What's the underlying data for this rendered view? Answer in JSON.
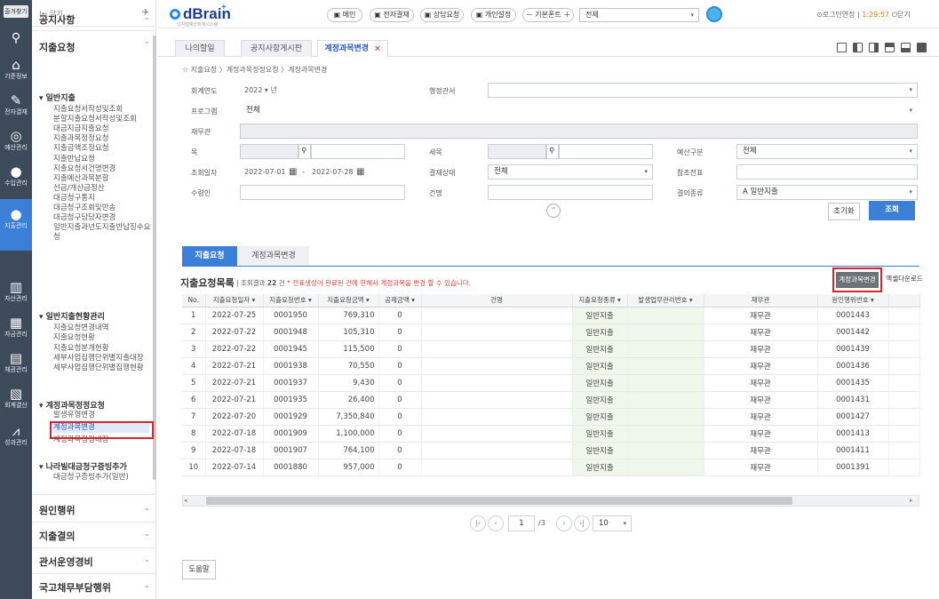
{
  "rail": {
    "favorites": "즐겨찾기",
    "items": [
      {
        "label": "기준정보",
        "icon": "house-icon"
      },
      {
        "label": "전자결재",
        "icon": "pen-icon"
      },
      {
        "label": "예산관리",
        "icon": "coins-icon"
      },
      {
        "label": "수입관리",
        "icon": "income-icon"
      },
      {
        "label": "지출관리",
        "icon": "expense-icon"
      },
      {
        "label": "자산관리",
        "icon": "building-icon"
      },
      {
        "label": "자금관리",
        "icon": "money-icon"
      },
      {
        "label": "채권관리",
        "icon": "bond-icon"
      },
      {
        "label": "회계결산",
        "icon": "document-icon"
      },
      {
        "label": "성과관리",
        "icon": "chart-icon"
      }
    ]
  },
  "sidebar": {
    "close": "|← 닫기",
    "sections_top": [
      {
        "label": "공지사항"
      },
      {
        "label": "지출요청"
      }
    ],
    "group1": "▾ 일반지출",
    "group1_items": [
      "지출요청서작성및조회",
      "분할지출요청서작성및조회",
      "대금지급지출요청",
      "지출과목정정요청",
      "지출금액조정요청",
      "지출반납요청",
      "지출요청서건명변경",
      "지출예산과목분할",
      "선급/개산급정산",
      "대금청구통지",
      "대금청구조회및반송",
      "대금청구담당자변경",
      "일반지출과년도지출반납징수요",
      "청"
    ],
    "group2": "▾ 일반지출현황관리",
    "group2_items": [
      "지출요청변경내역",
      "지출요청현황",
      "지출요청분개현황",
      "세부사업집행단위별지출대장",
      "세부사업집행단위별집행현황"
    ],
    "group3": "▾ 계정과목정정요청",
    "group3_items": [
      "발생유형변경",
      "계정과목변경",
      "계정과목정정내장"
    ],
    "group4": "▾ 나라빌대금청구증빙추가",
    "group4_items": [
      "대금청구증빙추가(일반)"
    ],
    "sections_bottom": [
      "원인행위",
      "지출결의",
      "관서운영경비",
      "국고채무부담행위"
    ]
  },
  "topbar": {
    "logo": "dBrain",
    "logo_plus": "+",
    "logo_sub": "디지털예산회계시스템",
    "buttons": [
      "메인",
      "전자결재",
      "상담요청",
      "개인설정"
    ],
    "font": "－ 기본폰트 ＋",
    "view_select": "전체",
    "login_ext": "⊙로그인연장",
    "timer": "1:29:57",
    "close": "⏻닫기"
  },
  "tabs": {
    "items": [
      {
        "label": "나의할일"
      },
      {
        "label": "공지사항게시판"
      },
      {
        "label": "계정과목변경",
        "close": "×"
      }
    ]
  },
  "breadcrumb": "☆ 지출요청 〉계정과목정정요청 〉계정과목변경",
  "form": {
    "fiscal_year_label": "회계연도",
    "fiscal_year": "2022",
    "year_unit": "▾ 년",
    "ministry_label": "행정관서",
    "ministry": "",
    "program_label": "프로그램",
    "program": "전체",
    "officer_label": "재무관",
    "officer": "",
    "item_label": "목",
    "item": "",
    "sub_item_label": "세목",
    "sub_item": "",
    "budget_type_label": "예산구분",
    "budget_type": "전체",
    "date_label": "조회일자",
    "date_from": "2022-07-01",
    "date_to": "2022-07-28",
    "approval_label": "결재상태",
    "approval": "전체",
    "ref_label": "참조전표",
    "ref": "",
    "payee_label": "수령인",
    "payee": "",
    "title_label": "건명",
    "title": "",
    "resolution_label": "결의종류",
    "resolution": "A 일반지출",
    "reset": "초기화",
    "search": "조회"
  },
  "subtabs": {
    "a": "지출요청",
    "b": "계정과목변경"
  },
  "list": {
    "title": "지출요청목록",
    "count_prefix": "조회결과",
    "count": "22",
    "count_suffix": "건",
    "notice": "* 전표생성이 완료된 건에 한해서 계정과목을 변경 할 수 있습니다.",
    "change_btn": "계정과목변경",
    "excel_btn": "엑셀다운로드",
    "columns": [
      "No.",
      "지출요청일자 ▾",
      "지출요청번호 ▾",
      "지출요청금액 ▾",
      "공제금액 ▾",
      "건명",
      "지출요청종류 ▾",
      "발생업무관리번호 ▾",
      "재무관",
      "원인행위번호 ▾"
    ],
    "rows": [
      [
        "1",
        "2022-07-25",
        "0001950",
        "769,310",
        "0",
        "",
        "일반지출",
        "",
        "재무관",
        "0001443"
      ],
      [
        "2",
        "2022-07-22",
        "0001948",
        "105,310",
        "0",
        "",
        "일반지출",
        "",
        "재무관",
        "0001442"
      ],
      [
        "3",
        "2022-07-22",
        "0001945",
        "115,500",
        "0",
        "",
        "일반지출",
        "",
        "재무관",
        "0001439"
      ],
      [
        "4",
        "2022-07-21",
        "0001938",
        "70,550",
        "0",
        "",
        "일반지출",
        "",
        "재무관",
        "0001436"
      ],
      [
        "5",
        "2022-07-21",
        "0001937",
        "9,430",
        "0",
        "",
        "일반지출",
        "",
        "재무관",
        "0001435"
      ],
      [
        "6",
        "2022-07-21",
        "0001935",
        "26,400",
        "0",
        "",
        "일반지출",
        "",
        "재무관",
        "0001431"
      ],
      [
        "7",
        "2022-07-20",
        "0001929",
        "7,350,840",
        "0",
        "",
        "일반지출",
        "",
        "재무관",
        "0001427"
      ],
      [
        "8",
        "2022-07-18",
        "0001909",
        "1,100,000",
        "0",
        "",
        "일반지출",
        "",
        "재무관",
        "0001413"
      ],
      [
        "9",
        "2022-07-18",
        "0001907",
        "764,100",
        "0",
        "",
        "일반지출",
        "",
        "재무관",
        "0001411"
      ],
      [
        "10",
        "2022-07-14",
        "0001880",
        "957,000",
        "0",
        "",
        "일반지출",
        "",
        "재무관",
        "0001391"
      ]
    ]
  },
  "pagination": {
    "page": "1",
    "total": "/3",
    "size": "10"
  },
  "help": "도움말"
}
